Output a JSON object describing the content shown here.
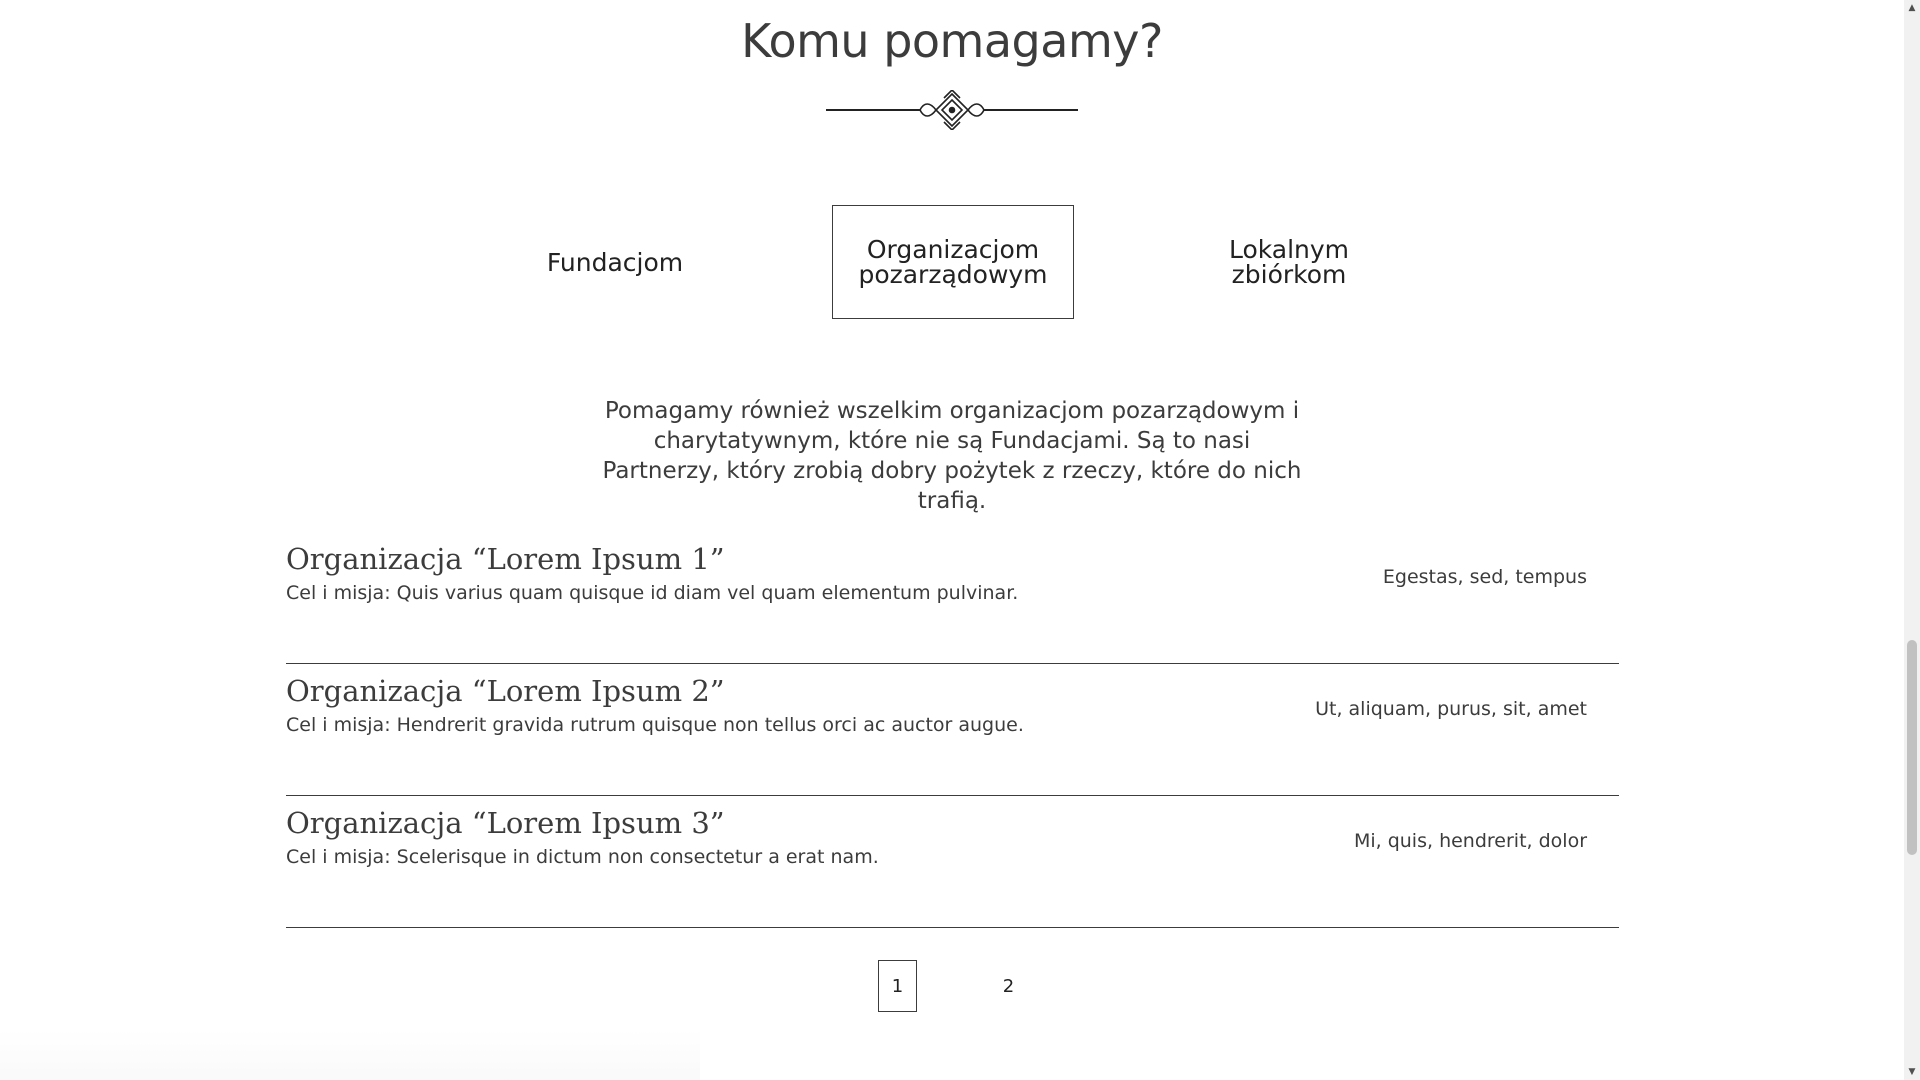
{
  "section": {
    "title": "Komu pomagamy?",
    "ornament_icon": "decorative-divider"
  },
  "tabs": [
    {
      "label": "Fundacjom",
      "active": false
    },
    {
      "label": "Organizacjom pozarządowym",
      "active": true
    },
    {
      "label": "Lokalnym zbiórkom",
      "active": false
    }
  ],
  "description": "Pomagamy również wszelkim organizacjom pozarządowym i charytatywnym, które nie są Fundacjami. Są to nasi Partnerzy, który zrobią dobry pożytek z rzeczy, które do nich trafią.",
  "organizations": [
    {
      "name": "Organizacja “Lorem Ipsum 1”",
      "mission": "Cel i misja: Quis varius quam quisque id diam vel quam elementum pulvinar.",
      "tags": "Egestas, sed, tempus"
    },
    {
      "name": "Organizacja “Lorem Ipsum 2”",
      "mission": "Cel i misja: Hendrerit gravida rutrum quisque non tellus orci ac auctor augue.",
      "tags": "Ut, aliquam, purus, sit, amet"
    },
    {
      "name": "Organizacja “Lorem Ipsum 3”",
      "mission": "Cel i misja: Scelerisque in dictum non consectetur a erat nam.",
      "tags": "Mi, quis, hendrerit, dolor"
    }
  ],
  "pagination": {
    "pages": [
      "1",
      "2"
    ],
    "current": "1"
  },
  "scrollbar": {
    "up_icon": "▲",
    "down_icon": "▼"
  }
}
